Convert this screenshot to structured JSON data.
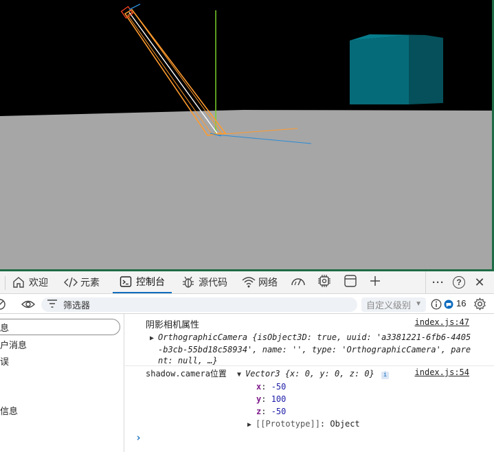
{
  "devtools": {
    "tabs": [
      {
        "label": "欢迎",
        "icon": "home-icon"
      },
      {
        "label": "元素",
        "icon": "code-icon"
      },
      {
        "label": "控制台",
        "icon": "console-icon"
      },
      {
        "label": "源代码",
        "icon": "bug-icon"
      },
      {
        "label": "网络",
        "icon": "wifi-icon"
      },
      {
        "label": "",
        "icon": "performance-icon"
      },
      {
        "label": "",
        "icon": "chip-icon"
      },
      {
        "label": "",
        "icon": "application-icon"
      },
      {
        "label": "",
        "icon": "plus-icon"
      }
    ],
    "active_tab": "控制台",
    "more_glyph": "···",
    "help_glyph": "?",
    "close_glyph": "✕"
  },
  "filter": {
    "placeholder": "筛选器",
    "levels_label": "自定义级别",
    "issues_count": "16"
  },
  "sidebar": {
    "items": [
      "息",
      "户消息",
      "误",
      "信息"
    ]
  },
  "console": {
    "messages": [
      {
        "label": "阴影相机属性",
        "source": "index.js:47",
        "object_class": "OrthographicCamera",
        "object_line1": "{isObject3D: true, uuid: 'a3381221-6fb6-4405",
        "object_line2": "-b3cb-55bd18c58934', name: '', type: 'OrthographicCamera', pare",
        "object_line3": "nt: null, …}"
      },
      {
        "label": "shadow.camera位置",
        "source": "index.js:54",
        "object_class": "Vector3",
        "object_summary": "{x: 0, y: 0, z: 0}",
        "info_badge": "i",
        "props": [
          {
            "key": "x",
            "value": "-50"
          },
          {
            "key": "y",
            "value": "100"
          },
          {
            "key": "z",
            "value": "-50"
          }
        ],
        "prototype_label": "[[Prototype]]",
        "prototype_value": "Object"
      }
    ],
    "prompt": "›"
  },
  "scene": {
    "background": "#000000",
    "ground_color": "#a6a6a6",
    "cube_color": "#066573",
    "axis_colors": {
      "x": "#ff9b2e",
      "y": "#7ad12a",
      "z": "#2a8bd6"
    }
  },
  "colors": {
    "accent": "#0f6cbd",
    "link": "#1f1f1f"
  }
}
